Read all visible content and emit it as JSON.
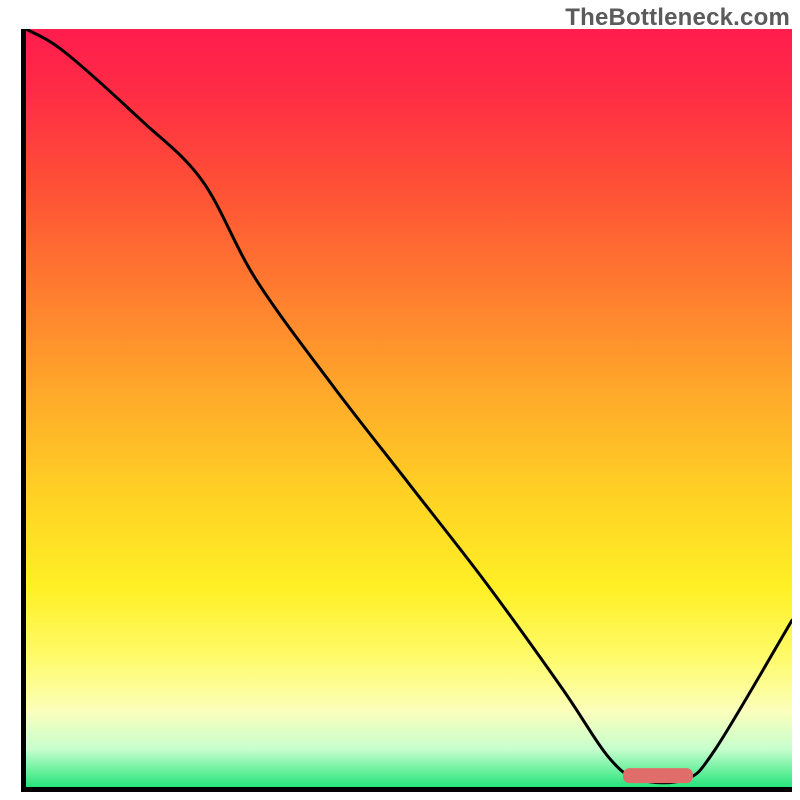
{
  "watermark": "TheBottleneck.com",
  "chart_data": {
    "type": "line",
    "title": "",
    "xlabel": "",
    "ylabel": "",
    "xlim": [
      0,
      100
    ],
    "ylim": [
      0,
      100
    ],
    "x": [
      0,
      5,
      15,
      23,
      30,
      40,
      50,
      60,
      70,
      76,
      80,
      86,
      90,
      100
    ],
    "values": [
      100,
      97,
      88,
      80,
      67,
      53,
      40,
      27,
      13,
      4,
      1,
      1,
      5,
      22
    ],
    "optimum_band": {
      "x_start": 78,
      "x_end": 87,
      "y": 1.5
    },
    "background": {
      "type": "vertical-gradient",
      "stops": [
        {
          "pos": 0.0,
          "color": "#ff1d4e"
        },
        {
          "pos": 0.22,
          "color": "#ff5435"
        },
        {
          "pos": 0.48,
          "color": "#ffa92a"
        },
        {
          "pos": 0.74,
          "color": "#fff026"
        },
        {
          "pos": 0.95,
          "color": "#c7ffce"
        },
        {
          "pos": 1.0,
          "color": "#26e57b"
        }
      ]
    }
  }
}
